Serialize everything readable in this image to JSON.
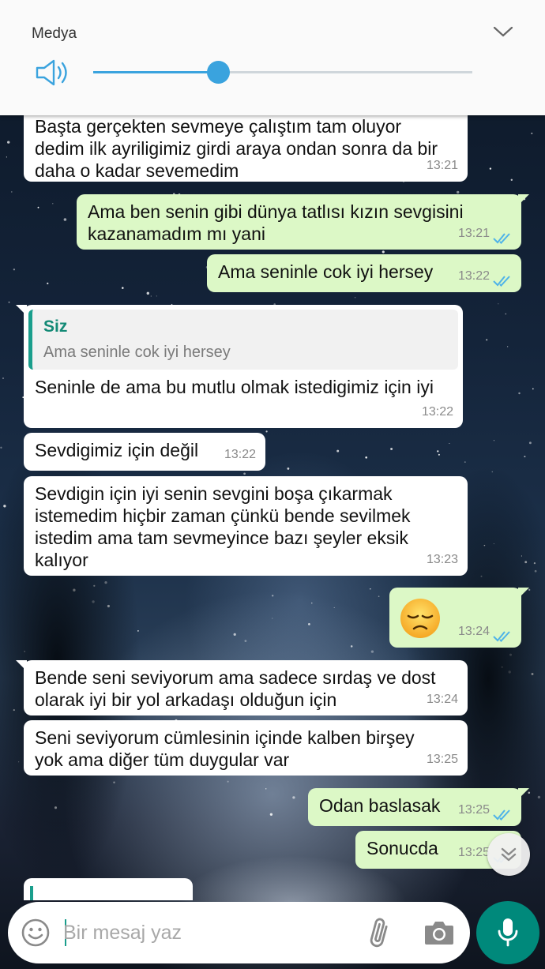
{
  "media_panel": {
    "title": "Medya",
    "volume_level": 0.33
  },
  "messages": [
    {
      "dir": "in",
      "text": "Başta gerçekten sevmeye çalıştım tam oluyor\ndedim ilk ayriligimiz girdi araya ondan sonra da bir\ndaha o kadar sevemedim",
      "time": "13:21"
    },
    {
      "dir": "out",
      "text": "Ama ben senin gibi dünya tatlısı kızın sevgisini\nkazanamadım mı yani",
      "time": "13:21",
      "status": "read"
    },
    {
      "dir": "out",
      "text": "Ama seninle cok iyi hersey",
      "time": "13:22",
      "status": "read"
    },
    {
      "dir": "in",
      "quote_name": "Siz",
      "quote_text": "Ama seninle cok iyi hersey",
      "text": "Seninle de ama bu mutlu olmak istedigimiz için iyi",
      "time": "13:22"
    },
    {
      "dir": "in",
      "text": "Sevdigimiz için değil",
      "time": "13:22"
    },
    {
      "dir": "in",
      "text": "Sevdigin için iyi senin sevgini boşa çıkarmak\nistemedim hiçbir zaman çünkü bende sevilmek\nistedim ama tam sevmeyince bazı şeyler eksik\nkalıyor",
      "time": "13:23"
    },
    {
      "dir": "out",
      "emoji": "pensive-face",
      "time": "13:24",
      "status": "read"
    },
    {
      "dir": "in",
      "text": "Bende seni seviyorum ama sadece sırdaş ve dost\nolarak iyi bir yol arkadaşı olduğun için",
      "time": "13:24"
    },
    {
      "dir": "in",
      "text": "Seni seviyorum cümlesinin içinde kalben birşey\nyok ama diğer tüm duygular var",
      "time": "13:25"
    },
    {
      "dir": "out",
      "text": "Odan baslasak",
      "time": "13:25",
      "status": "read"
    },
    {
      "dir": "out",
      "text": "Sonucda",
      "time": "13:25",
      "status": "read"
    }
  ],
  "composer": {
    "placeholder": "Bir mesaj yaz"
  },
  "colors": {
    "incoming": "#ffffff",
    "outgoing": "#dcf8c6",
    "accent": "#00897b",
    "read_ticks": "#4fb3e8",
    "slider": "#3aa3de"
  }
}
